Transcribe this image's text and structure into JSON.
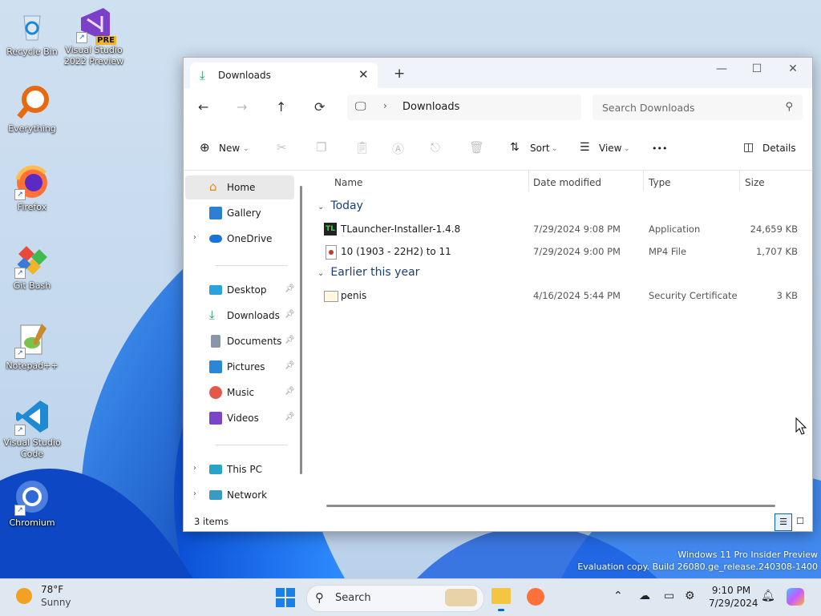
{
  "desktop": {
    "icons": [
      {
        "label": "Recycle Bin"
      },
      {
        "label": "Visual Studio 2022 Preview",
        "badge": "PRE"
      },
      {
        "label": "Everything"
      },
      {
        "label": "Firefox"
      },
      {
        "label": "Git Bash"
      },
      {
        "label": "Notepad++"
      },
      {
        "label": "Visual Studio Code"
      },
      {
        "label": "Chromium"
      }
    ],
    "watermark_line1": "Windows 11 Pro Insider Preview",
    "watermark_line2": "Evaluation copy. Build 26080.ge_release.240308-1400"
  },
  "window": {
    "tab_title": "Downloads",
    "tab_close": "✕",
    "new_tab": "+",
    "minimize": "—",
    "maximize": "☐",
    "close": "✕",
    "nav": {
      "back": "←",
      "forward": "→",
      "up": "↑",
      "refresh": "⟳"
    },
    "address": {
      "separator": "›",
      "crumb": "Downloads"
    },
    "search_placeholder": "Search Downloads",
    "toolbar": {
      "new_label": "New",
      "sort_label": "Sort",
      "view_label": "View",
      "more": "•••",
      "details_label": "Details"
    },
    "sidebar": {
      "home": "Home",
      "gallery": "Gallery",
      "onedrive": "OneDrive",
      "desktop": "Desktop",
      "downloads": "Downloads",
      "documents": "Documents",
      "pictures": "Pictures",
      "music": "Music",
      "videos": "Videos",
      "thispc": "This PC",
      "network": "Network"
    },
    "columns": {
      "name": "Name",
      "date": "Date modified",
      "type": "Type",
      "size": "Size"
    },
    "groups": [
      {
        "label": "Today",
        "files": [
          {
            "name": "TLauncher-Installer-1.4.8",
            "date": "7/29/2024 9:08 PM",
            "type": "Application",
            "size": "24,659 KB"
          },
          {
            "name": "10 (1903 - 22H2) to 11",
            "date": "7/29/2024 9:00 PM",
            "type": "MP4 File",
            "size": "1,707 KB"
          }
        ]
      },
      {
        "label": "Earlier this year",
        "files": [
          {
            "name": "penis",
            "date": "4/16/2024 5:44 PM",
            "type": "Security Certificate",
            "size": "3 KB"
          }
        ]
      }
    ],
    "status_count": "3 items"
  },
  "taskbar": {
    "weather_temp": "78°F",
    "weather_cond": "Sunny",
    "search_placeholder": "Search",
    "time": "9:10 PM",
    "date": "7/29/2024"
  },
  "colors": {
    "accent": "#0067c0",
    "group": "#1b3f74",
    "wallpaper": "#1e6fe0"
  }
}
